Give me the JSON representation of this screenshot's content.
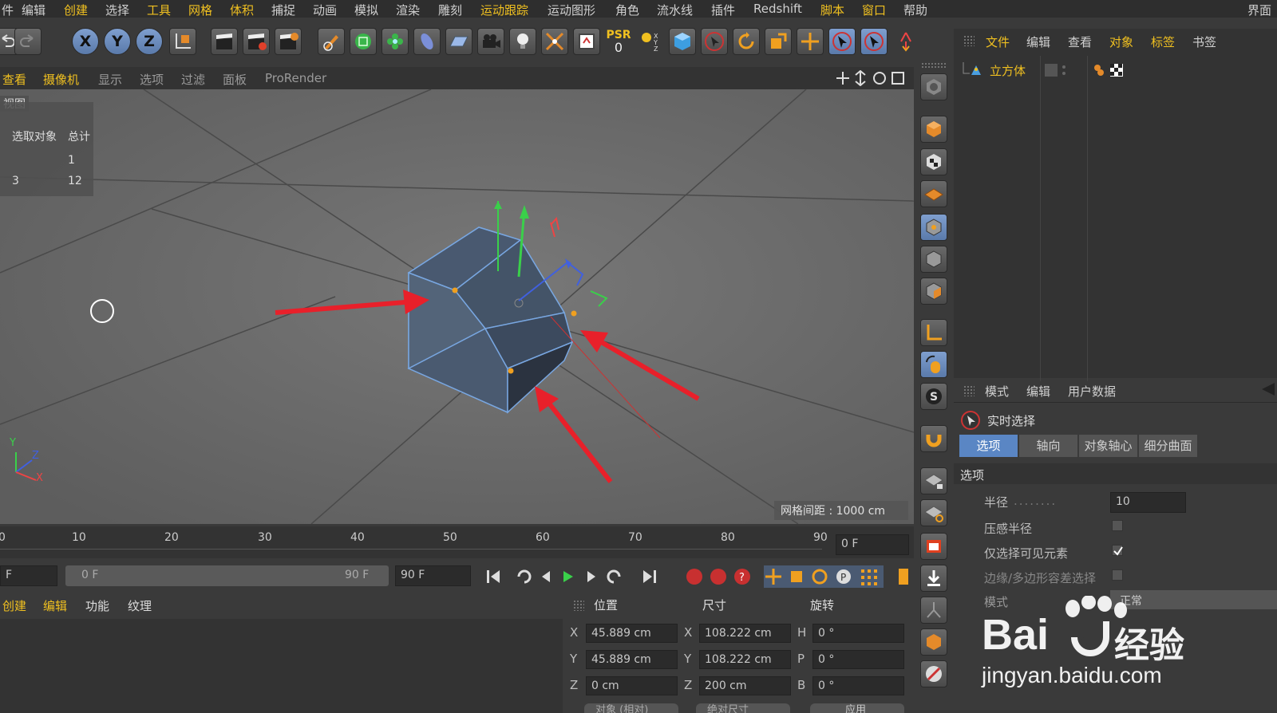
{
  "menubar": {
    "items": [
      "件",
      "编辑",
      "创建",
      "选择",
      "工具",
      "网格",
      "体积",
      "捕捉",
      "动画",
      "模拟",
      "渲染",
      "雕刻",
      "运动跟踪",
      "运动图形",
      "角色",
      "流水线",
      "插件",
      "Redshift",
      "脚本",
      "窗口",
      "帮助"
    ],
    "right_label": "界面"
  },
  "toolbar": {
    "x_label": "X",
    "y_label": "Y",
    "z_label": "Z",
    "psr_label": "PSR",
    "psr_value": "0"
  },
  "viewport_menu": {
    "items": [
      "查看",
      "摄像机",
      "显示",
      "选项",
      "过滤",
      "面板",
      "ProRender"
    ],
    "view_name": "视图",
    "stats": {
      "header_col1": "选取对象",
      "header_col2": "总计",
      "rows": [
        {
          "label": "",
          "col1": "1"
        },
        {
          "label": "3",
          "col1": "12"
        }
      ]
    },
    "grid_spacing": "网格间距 : 1000 cm",
    "axis_labels": {
      "y": "Y",
      "z": "Z",
      "x": "X"
    }
  },
  "timeline": {
    "ticks": [
      "0",
      "10",
      "20",
      "30",
      "40",
      "50",
      "60",
      "70",
      "80",
      "90"
    ],
    "current_frame": "0 F"
  },
  "transport": {
    "start_field": "F",
    "range_start": "0 F",
    "range_end": "90 F",
    "end_field": "90 F"
  },
  "materials": {
    "menu": [
      "创建",
      "编辑",
      "功能",
      "纹理"
    ]
  },
  "coords": {
    "headers": {
      "position": "位置",
      "size": "尺寸",
      "rotation": "旋转"
    },
    "rows": [
      {
        "axis": "X",
        "pos": "45.889 cm",
        "size_axis": "X",
        "size": "108.222 cm",
        "rot_axis": "H",
        "rot": "0 °"
      },
      {
        "axis": "Y",
        "pos": "45.889 cm",
        "size_axis": "Y",
        "size": "108.222 cm",
        "rot_axis": "P",
        "rot": "0 °"
      },
      {
        "axis": "Z",
        "pos": "0 cm",
        "size_axis": "Z",
        "size": "200 cm",
        "rot_axis": "B",
        "rot": "0 °"
      }
    ],
    "btn_object": "对象 (相对)",
    "btn_absolute": "绝对尺寸",
    "btn_apply": "应用"
  },
  "object_manager": {
    "tabs": [
      "文件",
      "编辑",
      "查看",
      "对象",
      "标签",
      "书签"
    ],
    "object_name": "立方体"
  },
  "attribute_manager": {
    "tabs": [
      "模式",
      "编辑",
      "用户数据"
    ],
    "tool_name": "实时选择",
    "subtabs": [
      "选项",
      "轴向",
      "对象轴心",
      "细分曲面"
    ],
    "section_title": "选项",
    "fields": {
      "radius_label": "半径",
      "radius_value": "10",
      "pressure_label": "压感半径",
      "visible_only_label": "仅选择可见元素",
      "edge_poly_label": "边缘/多边形容差选择",
      "mode_label": "模式",
      "mode_value": "正常"
    }
  },
  "watermark": {
    "brand": "Bai",
    "brand2": "经验",
    "url": "jingyan.baidu.com"
  },
  "colors": {
    "accent": "#f0c020",
    "selection_blue": "#5a86c4",
    "arrow_red": "#e8202a"
  }
}
